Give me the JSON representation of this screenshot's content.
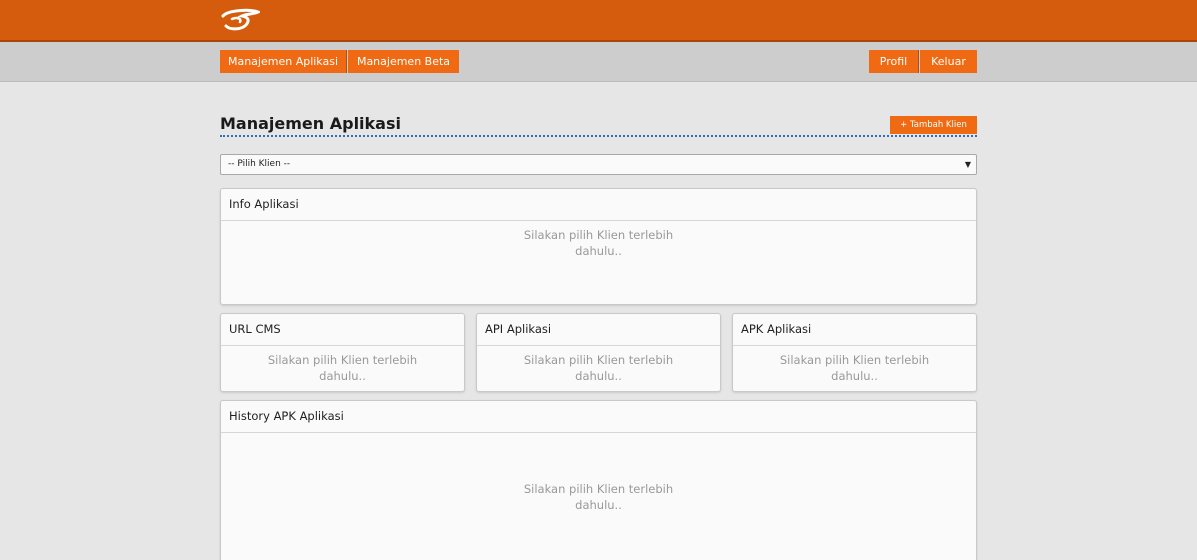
{
  "header": {
    "logo_icon": "brand-logo-icon",
    "brand_color": "#d45c0c"
  },
  "nav": {
    "left": [
      "Manajemen Aplikasi",
      "Manajemen Beta"
    ],
    "right": [
      "Profil",
      "Keluar"
    ],
    "accent": "#ef6a12"
  },
  "main": {
    "title": "Manajemen Aplikasi",
    "add_button": "+ Tambah Klien",
    "client_select": {
      "selected": "-- Pilih Klien --"
    }
  },
  "panels": {
    "info": {
      "title": "Info Aplikasi",
      "message": "Silakan pilih Klien terlebih dahulu.."
    },
    "url_cms": {
      "title": "URL CMS",
      "message": "Silakan pilih Klien terlebih dahulu.."
    },
    "api": {
      "title": "API Aplikasi",
      "message": "Silakan pilih Klien terlebih dahulu.."
    },
    "apk": {
      "title": "APK Aplikasi",
      "message": "Silakan pilih Klien terlebih dahulu.."
    },
    "history": {
      "title": "History APK Aplikasi",
      "message": "Silakan pilih Klien terlebih dahulu.."
    }
  }
}
